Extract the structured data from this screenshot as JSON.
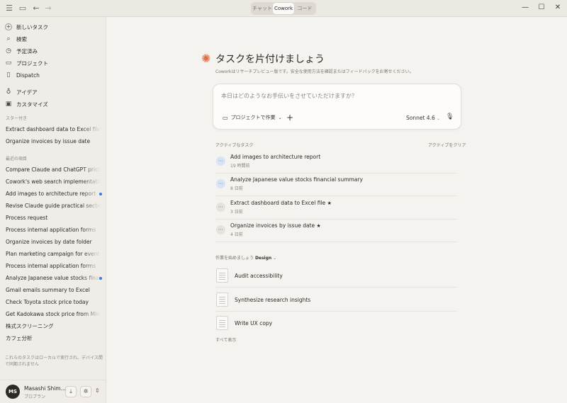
{
  "window": {
    "tabs": [
      "チャット",
      "Cowork",
      "コード"
    ],
    "active_tab": "Cowork"
  },
  "sidebar": {
    "nav": [
      {
        "label": "新しいタスク",
        "icon": "plus-icon"
      },
      {
        "label": "検索",
        "icon": "search-icon"
      },
      {
        "label": "予定済み",
        "icon": "clock-icon"
      },
      {
        "label": "プロジェクト",
        "icon": "folder-icon"
      },
      {
        "label": "Dispatch",
        "icon": "phone-icon"
      }
    ],
    "nav2": [
      {
        "label": "アイデア",
        "icon": "lightbulb-icon"
      },
      {
        "label": "カスタマイズ",
        "icon": "briefcase-icon"
      }
    ],
    "starred_label": "スター付き",
    "starred": [
      "Extract dashboard data to Excel file",
      "Organize invoices by issue date"
    ],
    "recent_label": "最近の項目",
    "recent": [
      "Compare Claude and ChatGPT pricing",
      "Cowork's web search implementation",
      "Add images to architecture report",
      "Revise Claude guide practical section",
      "Process request",
      "Process internal application forms",
      "Organize invoices by date folder",
      "Plan marketing campaign for event",
      "Process internal application forms",
      "Analyze Japanese value stocks financial",
      "Gmail emails summary to Excel",
      "Check Toyota stock price today",
      "Get Kadokawa stock price from Minkabu",
      "株式スクリーニング",
      "カフェ分析"
    ],
    "footer_note": "これらのタスクはローカルで実行され、デバイス間で同期されません",
    "user": {
      "initials": "MS",
      "name": "Masashi Shim...",
      "plan": "プロプラン"
    }
  },
  "main": {
    "title": "タスクを片付けましょう",
    "subtitle": "Coworkはリサーチプレビュー版です。安全な使用方法を確認またはフィードバックをお寄せください。",
    "prompt_placeholder": "本日はどのようなお手伝いをさせていただけますか？",
    "project_button": "プロジェクトで作業",
    "model": "Sonnet 4.6",
    "active_label": "アクティブなタスク",
    "clear_label": "アクティブをクリア",
    "active_tasks": [
      {
        "title": "Add images to architecture report",
        "time": "19 時間前",
        "starred": false,
        "running": true
      },
      {
        "title": "Analyze Japanese value stocks financial summary",
        "time": "8 日前",
        "starred": false,
        "running": true
      },
      {
        "title": "Extract dashboard data to Excel file",
        "time": "3 日前",
        "starred": true,
        "running": false
      },
      {
        "title": "Organize invoices by issue date",
        "time": "4 日前",
        "starred": true,
        "running": false
      }
    ],
    "start_label": "作業を始めましょう",
    "start_category": "Design",
    "templates": [
      "Audit accessibility",
      "Synthesize research insights",
      "Write UX copy"
    ],
    "show_all": "すべて表示"
  }
}
